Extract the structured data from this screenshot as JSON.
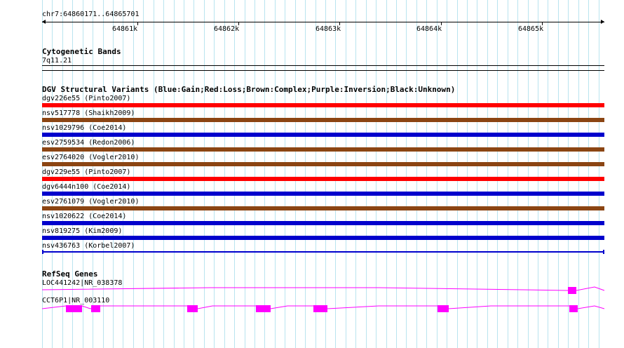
{
  "ruler": {
    "range_label": "chr7:64860171..64865701",
    "ticks": [
      "64861k",
      "64862k",
      "64863k",
      "64864k",
      "64865k"
    ]
  },
  "cytobands": {
    "title": "Cytogenetic Bands",
    "band": "7q11.21"
  },
  "dgv": {
    "title": "DGV Structural Variants (Blue:Gain;Red:Loss;Brown:Complex;Purple:Inversion;Black:Unknown)",
    "variants": [
      {
        "label": "dgv226e55 (Pinto2007)",
        "color": "#ff0000"
      },
      {
        "label": "nsv517778 (Shaikh2009)",
        "color": "#8b4513"
      },
      {
        "label": "nsv1029796 (Coe2014)",
        "color": "#0000cc"
      },
      {
        "label": "esv2759534 (Redon2006)",
        "color": "#8b4513"
      },
      {
        "label": "esv2764020 (Vogler2010)",
        "color": "#8b4513"
      },
      {
        "label": "dgv229e55 (Pinto2007)",
        "color": "#ff0000"
      },
      {
        "label": "dgv6444n100 (Coe2014)",
        "color": "#0000cc"
      },
      {
        "label": "esv2761079 (Vogler2010)",
        "color": "#8b4513"
      },
      {
        "label": "nsv1020622 (Coe2014)",
        "color": "#0000cc"
      },
      {
        "label": "nsv819275 (Kim2009)",
        "color": "#0000cc"
      },
      {
        "label": "nsv436763 (Korbel2007)",
        "color": "#0000cc"
      }
    ]
  },
  "refseq": {
    "title": "RefSeq Genes",
    "genes": [
      {
        "label": "LOC441242|NR_038378",
        "color": "#ff00ff"
      },
      {
        "label": "CCT6P1|NR_003110",
        "color": "#ff00ff"
      }
    ]
  }
}
